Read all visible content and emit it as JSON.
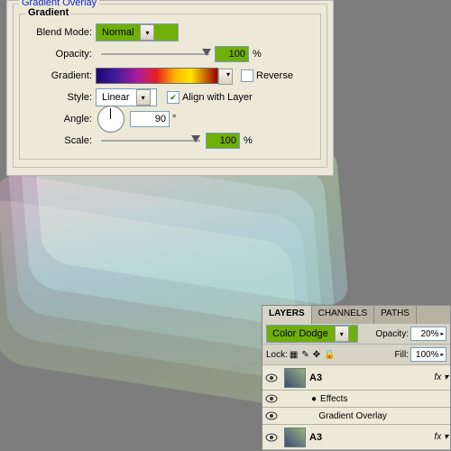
{
  "dialog": {
    "title": "Gradient Overlay",
    "group": "Gradient",
    "blend_mode_label": "Blend Mode:",
    "blend_mode_value": "Normal",
    "opacity_label": "Opacity:",
    "opacity_value": "100",
    "opacity_suffix": "%",
    "gradient_label": "Gradient:",
    "reverse_label": "Reverse",
    "reverse_checked": false,
    "style_label": "Style:",
    "style_value": "Linear",
    "align_label": "Align with Layer",
    "align_checked": true,
    "angle_label": "Angle:",
    "angle_value": "90",
    "angle_suffix": "°",
    "scale_label": "Scale:",
    "scale_value": "100",
    "scale_suffix": "%"
  },
  "layers_panel": {
    "tabs": [
      "LAYERS",
      "CHANNELS",
      "PATHS"
    ],
    "blend_mode": "Color Dodge",
    "opacity_label": "Opacity:",
    "opacity_value": "20%",
    "lock_label": "Lock:",
    "fill_label": "Fill:",
    "fill_value": "100%",
    "layers": [
      {
        "name": "A3",
        "has_fx": true
      },
      {
        "name": "A3",
        "has_fx": true
      }
    ],
    "effects_label": "Effects",
    "effect_item": "Gradient Overlay"
  }
}
